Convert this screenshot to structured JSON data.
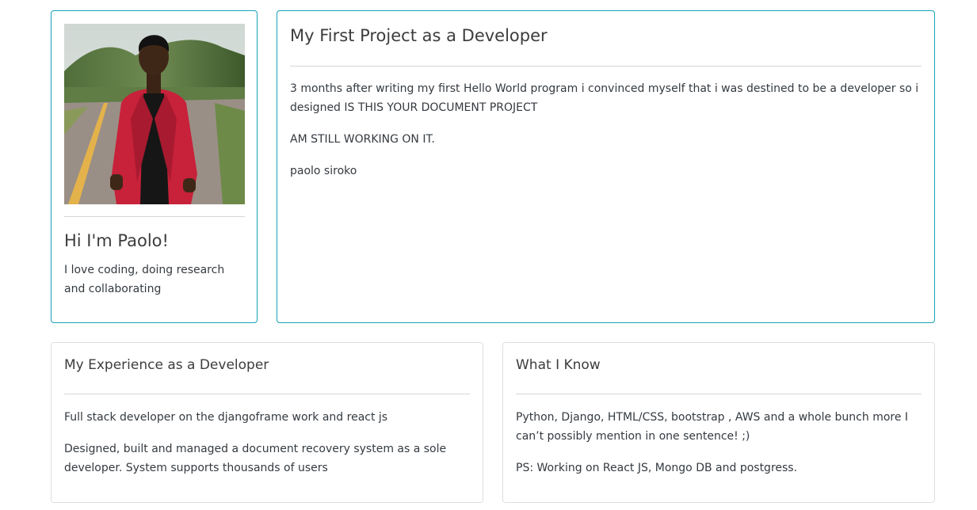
{
  "profile": {
    "name": "Hi I'm Paolo!",
    "bio": "I love coding, doing research and collaborating"
  },
  "project": {
    "title": "My First Project as a Developer",
    "paragraphs": [
      "3 months after writing my first Hello World program i convinced myself that i was destined to be a developer so i designed IS THIS YOUR DOCUMENT PROJECT",
      "AM STILL WORKING ON IT.",
      "paolo siroko"
    ]
  },
  "experience": {
    "title": "My Experience as a Developer",
    "paragraphs": [
      "Full stack developer on the djangoframe work and react js",
      "Designed, built and managed a document recovery system as a sole developer. System supports thousands of users"
    ]
  },
  "skills": {
    "title": "What I Know",
    "paragraphs": [
      "Python, Django, HTML/CSS, bootstrap , AWS and a whole bunch more I can’t possibly mention in one sentence! ;)",
      "PS: Working on React JS, Mongo DB and postgress."
    ]
  },
  "colors": {
    "accent_border": "#17a2b8",
    "plain_border": "#dfdfdf",
    "jacket": "#c8213a"
  }
}
